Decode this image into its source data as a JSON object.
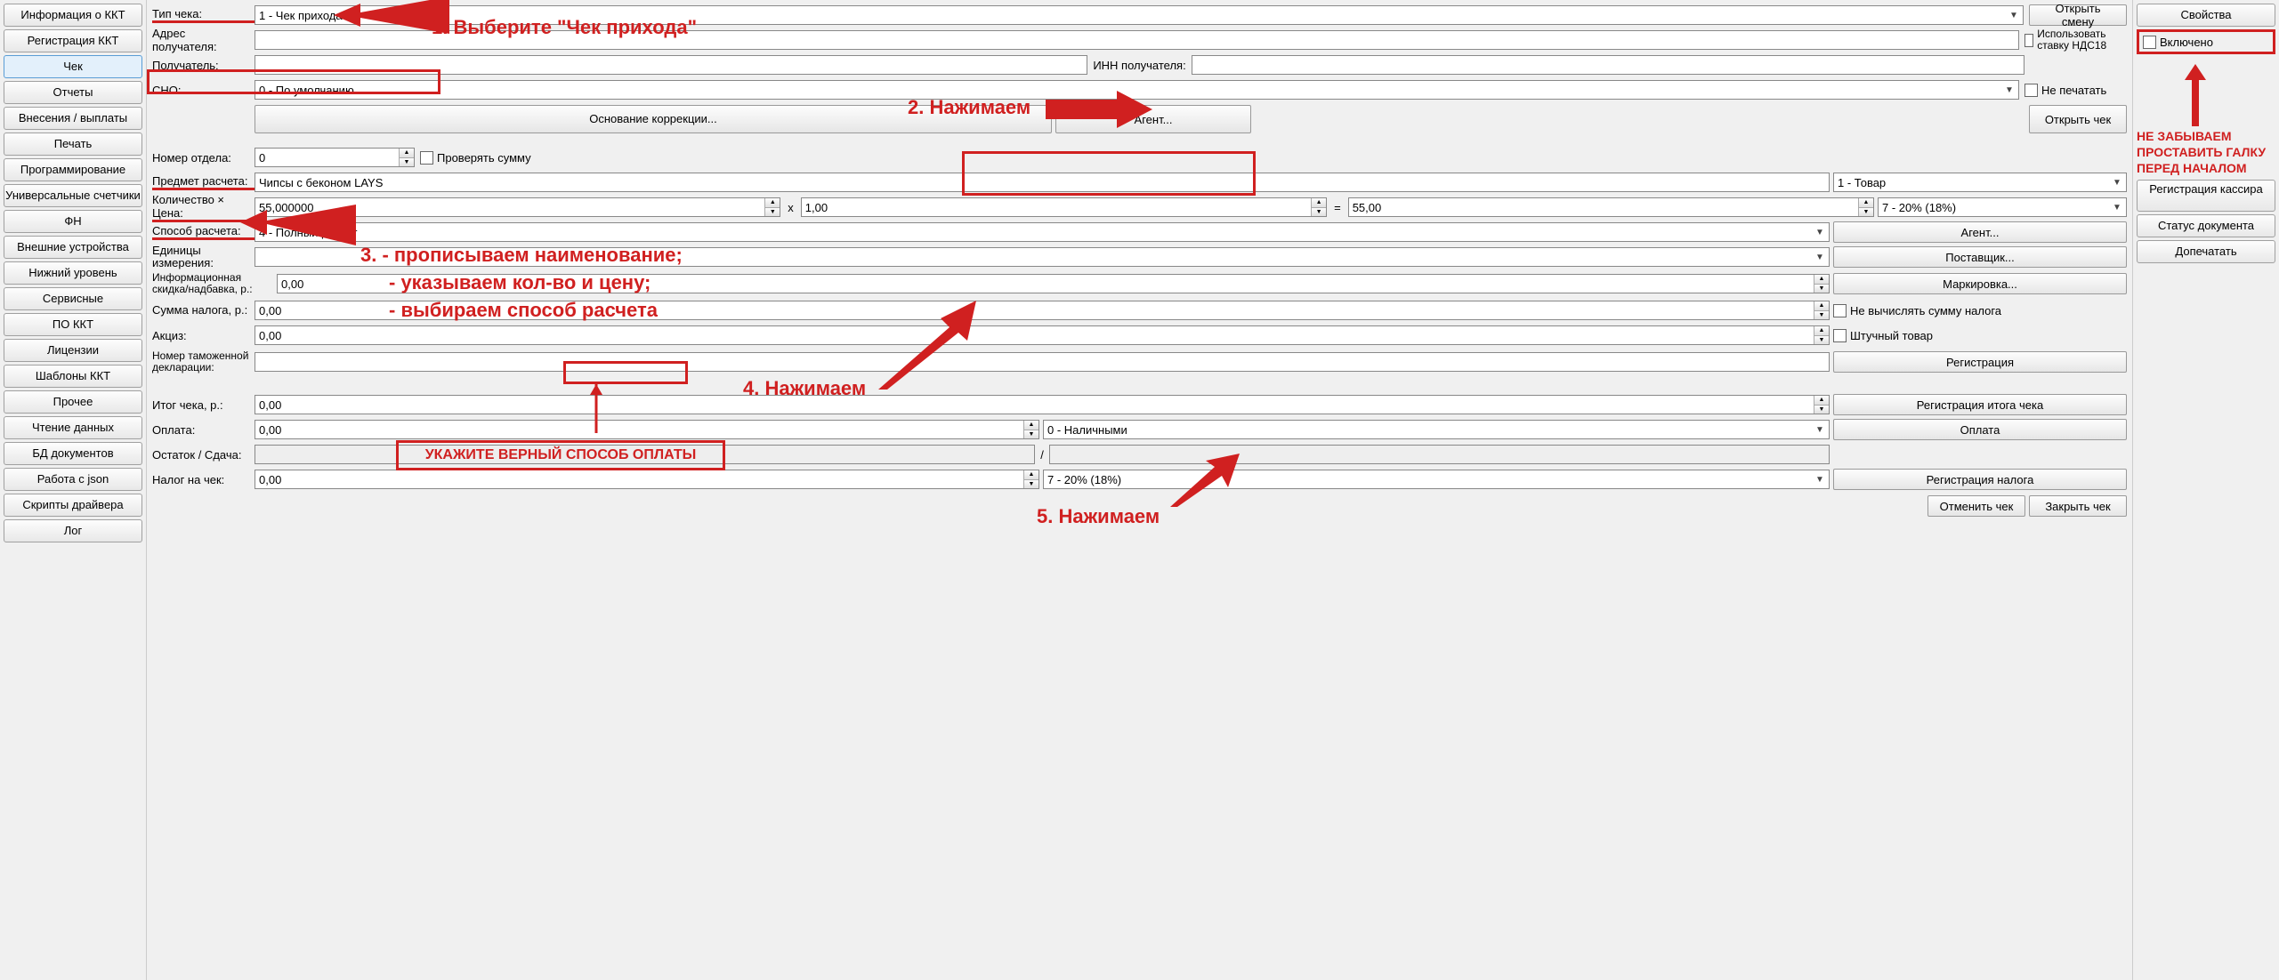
{
  "sidebar_left": [
    "Информация о ККТ",
    "Регистрация ККТ",
    "Чек",
    "Отчеты",
    "Внесения / выплаты",
    "Печать",
    "Программирование",
    "Универсальные счетчики",
    "ФН",
    "Внешние устройства",
    "Нижний уровень",
    "Сервисные",
    "ПО ККТ",
    "Лицензии",
    "Шаблоны ККТ",
    "Прочее",
    "Чтение данных",
    "БД документов",
    "Работа с json",
    "Скрипты драйвера",
    "Лог"
  ],
  "sidebar_left_active": 2,
  "header": {
    "tip_cheka_lbl": "Тип чека:",
    "tip_cheka_val": "1 - Чек прихода",
    "open_shift": "Открыть смену",
    "adres_lbl": "Адрес получателя:",
    "nds18_lbl": "Использовать ставку НДС18",
    "poluch_lbl": "Получатель:",
    "inn_lbl": "ИНН получателя:",
    "sno_lbl": "СНО:",
    "sno_val": "0 - По умолчанию",
    "ne_pechat": "Не печатать",
    "osn_korr": "Основание коррекции...",
    "agent": "Агент...",
    "open_check": "Открыть чек"
  },
  "item": {
    "nomer_otdela_lbl": "Номер отдела:",
    "nomer_otdela_val": "0",
    "prov_sum": "Проверять сумму",
    "predmet_lbl": "Предмет расчета:",
    "predmet_val": "Чипсы с беконом LAYS",
    "predmet_type": "1 - Товар",
    "qty_price_lbl": "Количество × Цена:",
    "qty_val": "55,000000",
    "x": "x",
    "price_val": "1,00",
    "eq": "=",
    "sum_val": "55,00",
    "vat": "7 - 20% (18%)",
    "sposob_lbl": "Способ расчета:",
    "sposob_val": "4 - Полный расчет",
    "agent_btn": "Агент...",
    "ed_izm_lbl": "Единицы измерения:",
    "postav_btn": "Поставщик...",
    "skidka_lbl": "Информационная скидка/надбавка, р.:",
    "skidka_val": "0,00",
    "mark_btn": "Маркировка...",
    "sum_naloga_lbl": "Сумма налога, р.:",
    "sum_naloga_val": "0,00",
    "ne_vych": "Не вычислять сумму налога",
    "akciz_lbl": "Акциз:",
    "akciz_val": "0,00",
    "shtuch": "Штучный товар",
    "tamozh_lbl": "Номер таможенной декларации:",
    "reg_btn": "Регистрация"
  },
  "footer": {
    "itog_lbl": "Итог чека, р.:",
    "itog_val": "0,00",
    "reg_itog": "Регистрация итога чека",
    "oplata_lbl": "Оплата:",
    "oplata_val": "0,00",
    "oplata_type": "0 - Наличными",
    "oplata_btn": "Оплата",
    "ostatok_lbl": "Остаток / Сдача:",
    "slash": "/",
    "nalog_lbl": "Налог на чек:",
    "nalog_val": "0,00",
    "nalog_type": "7 - 20% (18%)",
    "reg_nalog": "Регистрация налога",
    "cancel_check": "Отменить чек",
    "close_check": "Закрыть чек"
  },
  "sidebar_right": {
    "props": "Свойства",
    "enabled": "Включено",
    "reg_kassira": "Регистрация кассира",
    "status_doc": "Статус документа",
    "dopechat": "Допечатать"
  },
  "annotations": {
    "step1": "1. Выберите \"Чек прихода\"",
    "step2": "2. Нажимаем",
    "step3a": "3. - прописываем наименование;",
    "step3b": "- указываем кол-во и цену;",
    "step3c": "- выбираем способ расчета",
    "step4": "4. Нажимаем",
    "step5": "5. Нажимаем",
    "pay_note": "УКАЖИТЕ ВЕРНЫЙ СПОСОБ ОПЛАТЫ",
    "right_note": "НЕ ЗАБЫВАЕМ ПРОСТАВИТЬ ГАЛКУ ПЕРЕД НАЧАЛОМ"
  }
}
